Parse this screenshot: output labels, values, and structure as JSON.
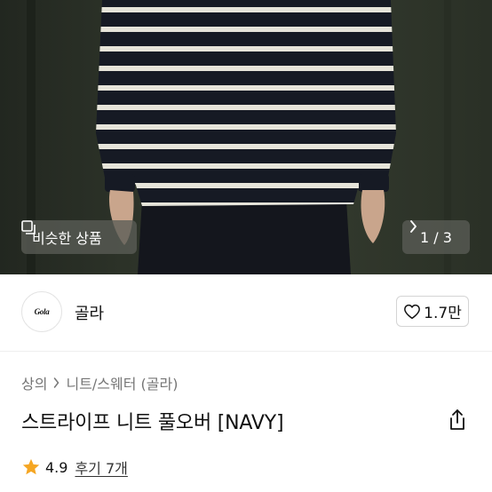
{
  "hero": {
    "similar_label": "비슷한 상품",
    "pager": "1 / 3",
    "icons": [
      "similar-icon",
      "chevron-right-icon"
    ]
  },
  "brand": {
    "logo_text": "Gola",
    "name": "골라",
    "like_count": "1.7만"
  },
  "breadcrumb": [
    "상의",
    "니트/스웨터 (골라)"
  ],
  "product": {
    "title": "스트라이프 니트 풀오버 [NAVY]"
  },
  "rating": {
    "score": "4.9",
    "reviews": "후기 7개"
  },
  "colors": {
    "star": "#f5a623",
    "sweater_navy": "#161a24",
    "stripe": "#e8e6dc",
    "wall": "#2f3528"
  }
}
